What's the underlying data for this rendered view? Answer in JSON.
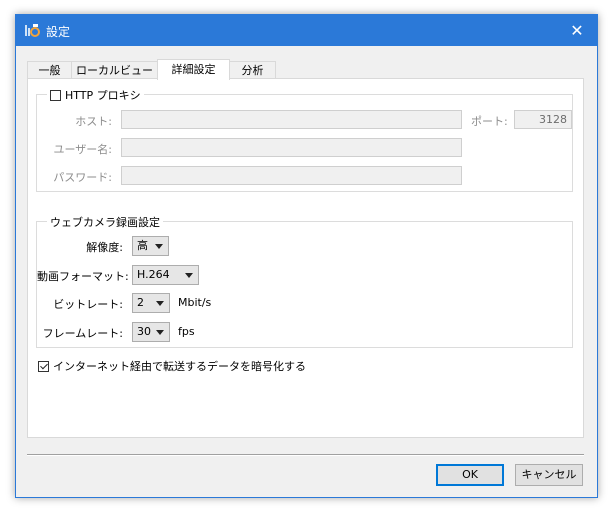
{
  "window": {
    "title": "設定",
    "close_glyph": "✕"
  },
  "tabs": [
    {
      "label": "一般"
    },
    {
      "label": "ローカルビュー"
    },
    {
      "label": "詳細設定",
      "active": true
    },
    {
      "label": "分析"
    }
  ],
  "proxy": {
    "checkbox_label": "HTTP プロキシ",
    "checked": false,
    "host_label": "ホスト:",
    "host_value": "",
    "port_label": "ポート:",
    "port_value": "3128",
    "username_label": "ユーザー名:",
    "username_value": "",
    "password_label": "パスワード:",
    "password_value": ""
  },
  "webcam": {
    "group_title": "ウェブカメラ録画設定",
    "resolution_label": "解像度:",
    "resolution_value": "高",
    "format_label": "動画フォーマット:",
    "format_value": "H.264",
    "bitrate_label": "ビットレート:",
    "bitrate_value": "2",
    "bitrate_unit": "Mbit/s",
    "framerate_label": "フレームレート:",
    "framerate_value": "30",
    "framerate_unit": "fps"
  },
  "encrypt": {
    "label": "インターネット経由で転送するデータを暗号化する",
    "checked": true
  },
  "buttons": {
    "ok": "OK",
    "cancel": "キャンセル"
  },
  "colors": {
    "titlebar": "#2b79d8",
    "accent": "#0078d7"
  }
}
